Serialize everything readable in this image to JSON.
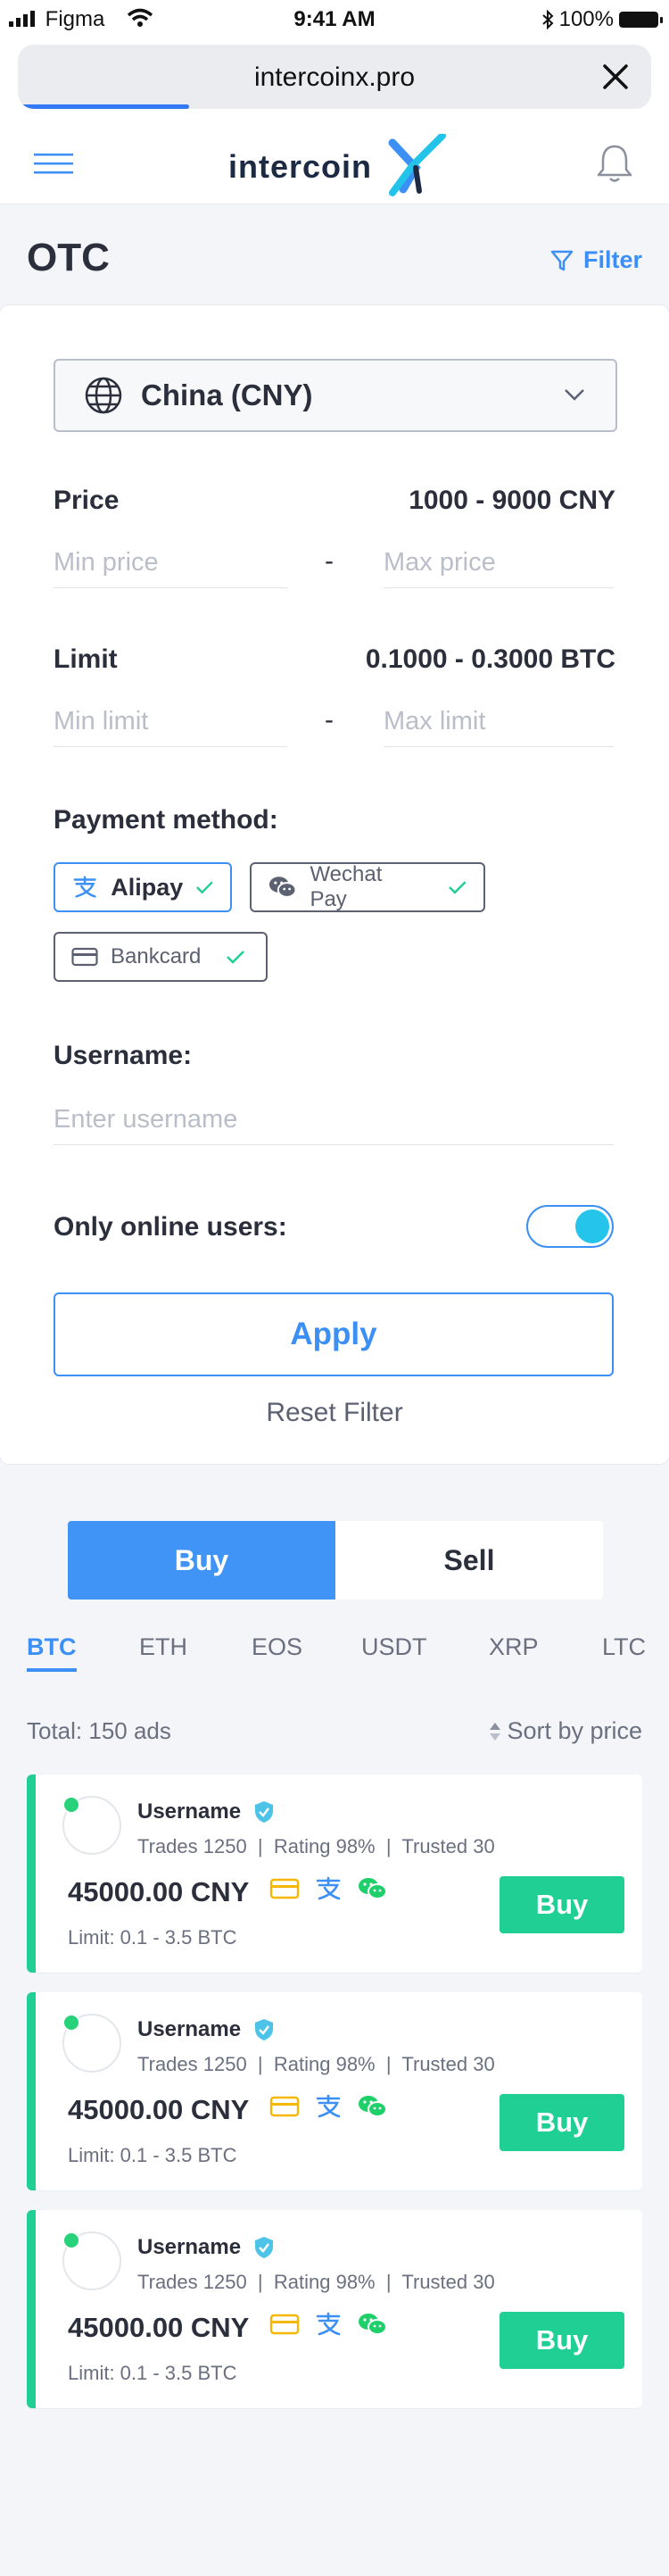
{
  "status_bar": {
    "carrier": "Figma",
    "time": "9:41 AM",
    "battery": "100%"
  },
  "browser": {
    "url": "intercoinx.pro",
    "load_progress_percent": 27
  },
  "header": {
    "logo_text": "intercoin",
    "logo_mark": "X"
  },
  "page": {
    "title": "OTC",
    "filter_label": "Filter"
  },
  "filter": {
    "country": "China (CNY)",
    "price_label": "Price",
    "price_range": "1000 - 9000 CNY",
    "min_price_placeholder": "Min price",
    "max_price_placeholder": "Max price",
    "limit_label": "Limit",
    "limit_range": "0.1000 - 0.3000 BTC",
    "min_limit_placeholder": "Min limit",
    "max_limit_placeholder": "Max limit",
    "separator": "-",
    "payment_label": "Payment method:",
    "payments": [
      {
        "label": "Alipay",
        "selected": true
      },
      {
        "label": "Wechat Pay",
        "selected": true
      },
      {
        "label": "Bankcard",
        "selected": true
      }
    ],
    "username_label": "Username:",
    "username_placeholder": "Enter username",
    "online_label": "Only online users:",
    "online_only": true,
    "apply_label": "Apply",
    "reset_label": "Reset Filter"
  },
  "trade": {
    "buy_label": "Buy",
    "sell_label": "Sell",
    "active": "Buy"
  },
  "coins": [
    "BTC",
    "ETH",
    "EOS",
    "USDT",
    "XRP",
    "LTC"
  ],
  "active_coin": "BTC",
  "listing": {
    "total": "Total: 150 ads",
    "sort": "Sort by price"
  },
  "ads": [
    {
      "username": "Username",
      "stats": "Trades 1250  |  Rating 98%  |  Trusted 30",
      "price": "45000.00 CNY",
      "limit": "Limit: 0.1 - 3.5 BTC",
      "button": "Buy"
    },
    {
      "username": "Username",
      "stats": "Trades 1250  |  Rating 98%  |  Trusted 30",
      "price": "45000.00 CNY",
      "limit": "Limit: 0.1 - 3.5 BTC",
      "button": "Buy"
    },
    {
      "username": "Username",
      "stats": "Trades 1250  |  Rating 98%  |  Trusted 30",
      "price": "45000.00 CNY",
      "limit": "Limit: 0.1 - 3.5 BTC",
      "button": "Buy"
    }
  ],
  "colors": {
    "accent": "#3b8ff5",
    "buy_green": "#1fcf94",
    "toggle_knob": "#25c4ea",
    "text": "#2a2f3b"
  }
}
